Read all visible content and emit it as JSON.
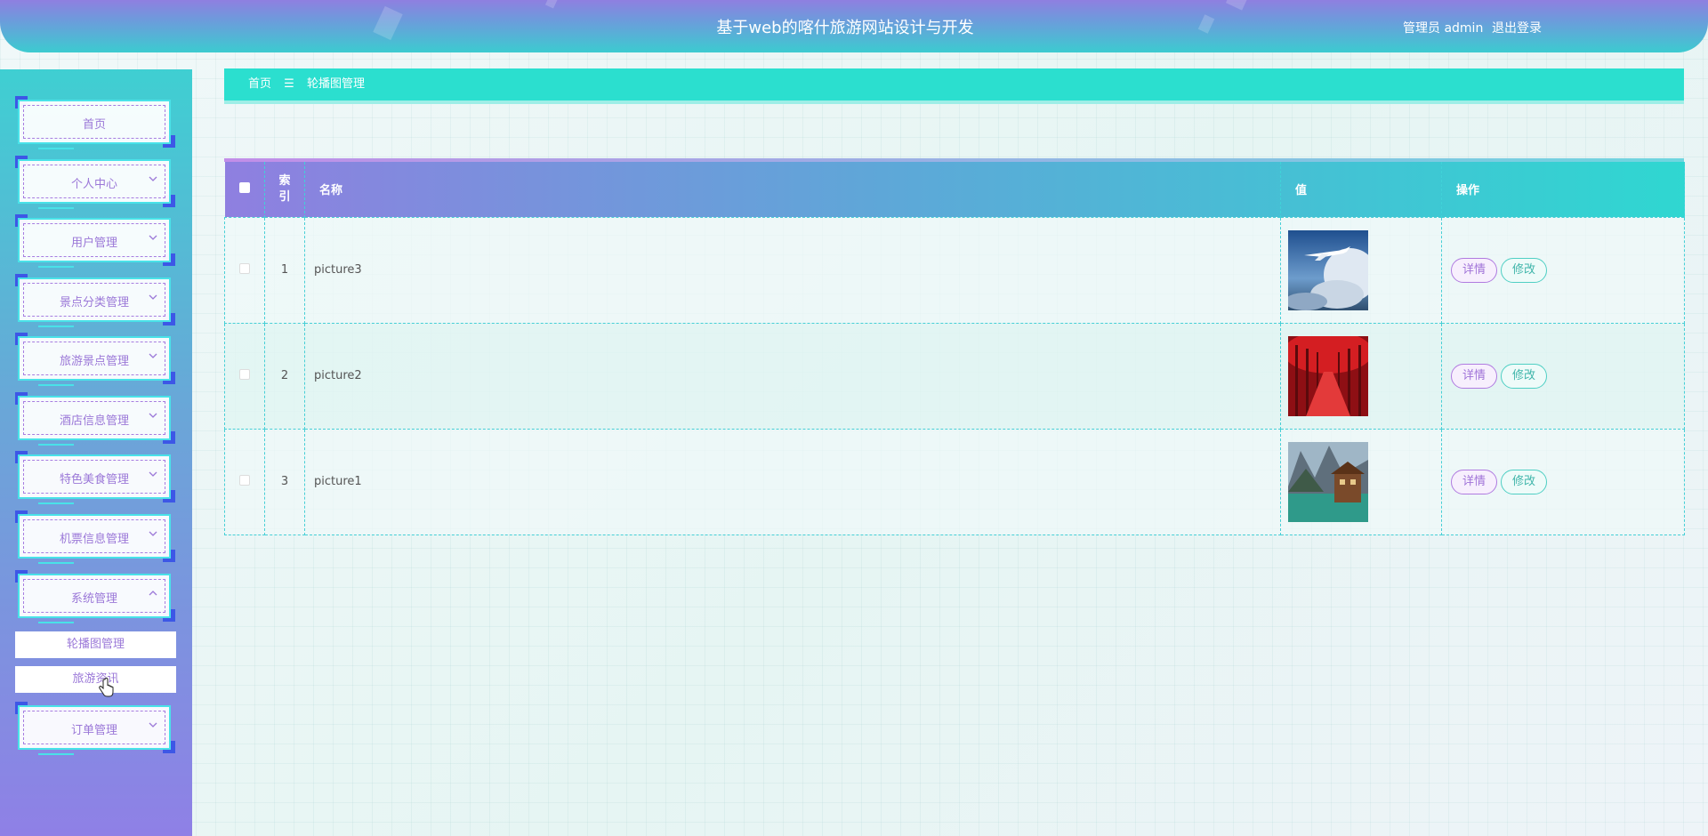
{
  "header": {
    "title": "基于web的喀什旅游网站设计与开发",
    "user": "管理员 admin",
    "logout": "退出登录"
  },
  "sidebar": {
    "items": [
      {
        "label": "首页"
      },
      {
        "label": "个人中心"
      },
      {
        "label": "用户管理"
      },
      {
        "label": "景点分类管理"
      },
      {
        "label": "旅游景点管理"
      },
      {
        "label": "酒店信息管理"
      },
      {
        "label": "特色美食管理"
      },
      {
        "label": "机票信息管理"
      },
      {
        "label": "系统管理"
      },
      {
        "label": "订单管理"
      }
    ],
    "sub_items": [
      {
        "label": "轮播图管理"
      },
      {
        "label": "旅游资讯"
      }
    ]
  },
  "breadcrumb": {
    "home": "首页",
    "separator": "☰",
    "current": "轮播图管理"
  },
  "table": {
    "headers": {
      "index": "索\n引",
      "name": "名称",
      "value": "值",
      "actions": "操作"
    },
    "rows": [
      {
        "index": "1",
        "name": "picture3",
        "image": "airplane-clouds",
        "detail": "详情",
        "edit": "修改"
      },
      {
        "index": "2",
        "name": "picture2",
        "image": "red-forest-path",
        "detail": "详情",
        "edit": "修改"
      },
      {
        "index": "3",
        "name": "picture1",
        "image": "mountain-lake-house",
        "detail": "详情",
        "edit": "修改"
      }
    ]
  },
  "colors": {
    "accent_teal": "#2bdfcf",
    "accent_purple": "#8f7fe0",
    "menu_text": "#9b78d8"
  }
}
